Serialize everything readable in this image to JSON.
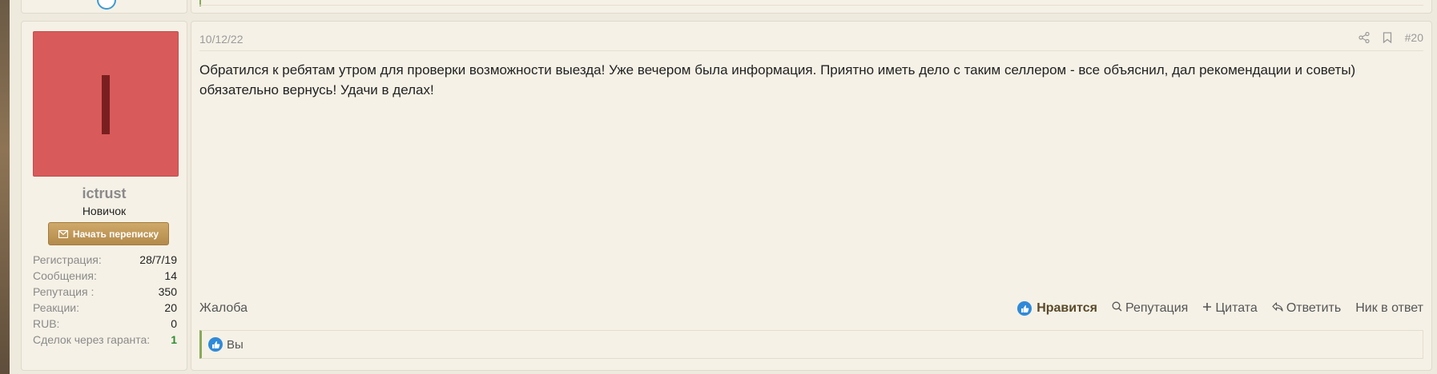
{
  "user": {
    "username": "ictrust",
    "rank": "Новичок",
    "pm_button": "Начать переписку",
    "avatar_color": "#d95a5a",
    "stats": [
      {
        "key": "Регистрация:",
        "value": "28/7/19"
      },
      {
        "key": "Сообщения:",
        "value": "14"
      },
      {
        "key": "Репутация :",
        "value": "350"
      },
      {
        "key": "Реакции:",
        "value": "20"
      },
      {
        "key": "RUB:",
        "value": "0"
      },
      {
        "key": "Сделок через гаранта:",
        "value": "1"
      }
    ]
  },
  "post": {
    "date": "10/12/22",
    "number": "#20",
    "body": "Обратился к ребятам утром для проверки возможности выезда! Уже вечером была информация. Приятно иметь дело с таким селлером - все объяснил, дал рекомендации и советы) обязательно вернусь! Удачи в делах!",
    "report": "Жалоба",
    "actions": {
      "like": "Нравится",
      "reputation": "Репутация",
      "quote": "Цитата",
      "reply": "Ответить",
      "nick": "Ник в ответ"
    },
    "reactions_text": "Вы"
  },
  "colors": {
    "accent_button": "#b48a4a",
    "like_blue": "#2f8ad8",
    "positive_green": "#2e8b2e"
  }
}
